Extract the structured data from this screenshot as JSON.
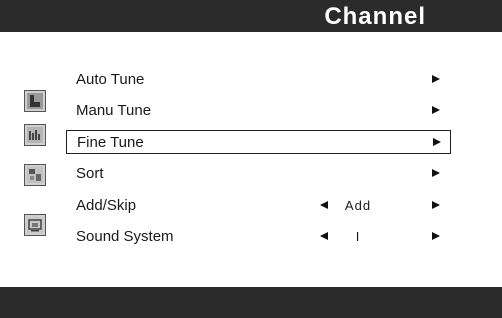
{
  "header": {
    "title": "Channel"
  },
  "menu": {
    "items": [
      {
        "label": "Auto Tune",
        "value": "",
        "has_left_arrow": false,
        "selected": false
      },
      {
        "label": "Manu Tune",
        "value": "",
        "has_left_arrow": false,
        "selected": false
      },
      {
        "label": "Fine Tune",
        "value": "",
        "has_left_arrow": false,
        "selected": true
      },
      {
        "label": "Sort",
        "value": "",
        "has_left_arrow": false,
        "selected": false
      },
      {
        "label": "Add/Skip",
        "value": "Add",
        "has_left_arrow": true,
        "selected": false
      },
      {
        "label": "Sound System",
        "value": "I",
        "has_left_arrow": true,
        "selected": false
      }
    ]
  },
  "icons": [
    {
      "name": "picture-menu-icon"
    },
    {
      "name": "sound-menu-icon"
    },
    {
      "name": "channel-menu-icon"
    },
    {
      "name": "function-menu-icon"
    }
  ],
  "colors": {
    "bar": "#2b2b2b",
    "background": "#ffffff",
    "text": "#1a1a1a"
  }
}
